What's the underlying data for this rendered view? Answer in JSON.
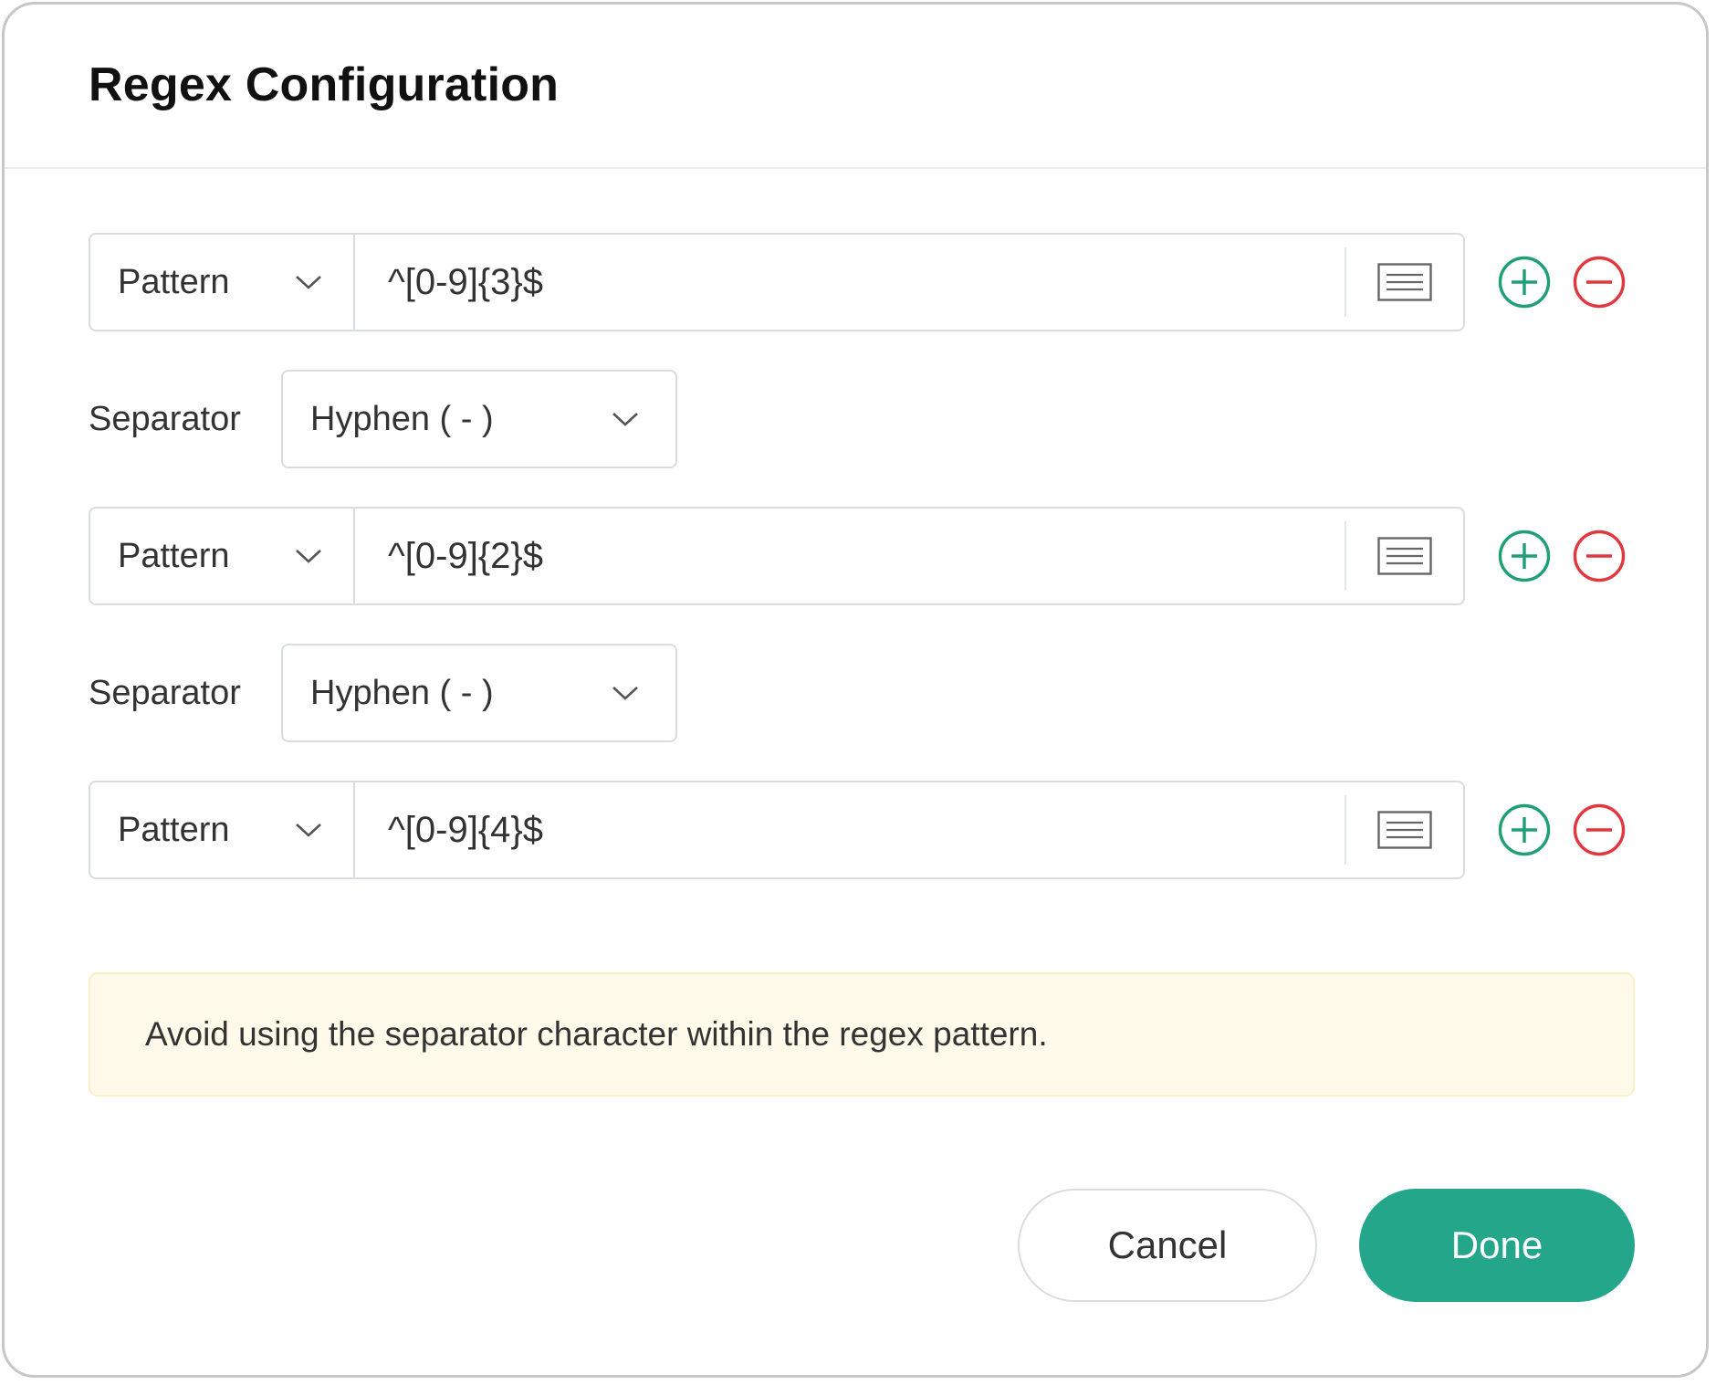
{
  "dialog": {
    "title": "Regex Configuration"
  },
  "rows": [
    {
      "type": "Pattern",
      "regex": "^[0-9]{3}$"
    },
    {
      "type": "Pattern",
      "regex": "^[0-9]{2}$"
    },
    {
      "type": "Pattern",
      "regex": "^[0-9]{4}$"
    }
  ],
  "separators": [
    {
      "label": "Separator",
      "value": "Hyphen ( - )"
    },
    {
      "label": "Separator",
      "value": "Hyphen ( - )"
    }
  ],
  "warning": {
    "text": "Avoid using the separator character within the regex pattern."
  },
  "footer": {
    "cancel_label": "Cancel",
    "done_label": "Done"
  },
  "colors": {
    "accent": "#24a68a",
    "add": "#1f9e78",
    "remove": "#e0383e",
    "warning_bg": "#fffaea"
  },
  "icons": {
    "chevron": "chevron-down-icon",
    "list": "list-icon",
    "add": "plus-circle-icon",
    "remove": "minus-circle-icon"
  }
}
